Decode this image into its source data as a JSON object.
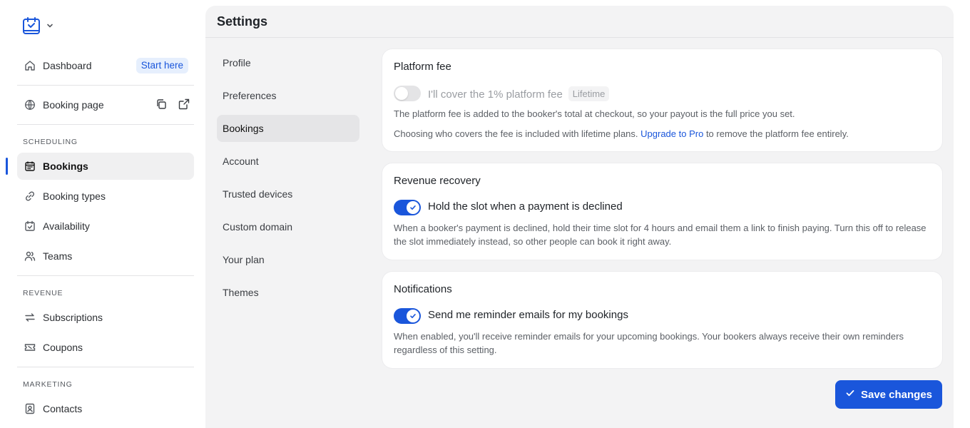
{
  "sidebar": {
    "logo_icon": "calendar-check-icon",
    "dashboard": {
      "label": "Dashboard",
      "badge": "Start here"
    },
    "booking_page": {
      "label": "Booking page"
    },
    "sections": [
      {
        "label": "SCHEDULING",
        "items": [
          "Bookings",
          "Booking types",
          "Availability",
          "Teams"
        ]
      },
      {
        "label": "REVENUE",
        "items": [
          "Subscriptions",
          "Coupons"
        ]
      },
      {
        "label": "MARKETING",
        "items": [
          "Contacts"
        ]
      }
    ],
    "active_item": "Bookings"
  },
  "main": {
    "title": "Settings",
    "sub_nav": [
      "Profile",
      "Preferences",
      "Bookings",
      "Account",
      "Trusted devices",
      "Custom domain",
      "Your plan",
      "Themes"
    ],
    "sub_nav_active": "Bookings",
    "cards": {
      "platform_fee": {
        "title": "Platform fee",
        "toggle_label": "I'll cover the 1% platform fee",
        "toggle_on": false,
        "pill": "Lifetime",
        "desc1": "The platform fee is added to the booker's total at checkout, so your payout is the full price you set.",
        "desc2_pre": "Choosing who covers the fee is included with lifetime plans.",
        "desc2_link": "Upgrade to Pro",
        "desc2_post": "to remove the platform fee entirely."
      },
      "revenue_recovery": {
        "title": "Revenue recovery",
        "toggle_label": "Hold the slot when a payment is declined",
        "toggle_on": true,
        "desc": "When a booker's payment is declined, hold their time slot for 4 hours and email them a link to finish paying. Turn this off to release the slot immediately instead, so other people can book it right away."
      },
      "notifications": {
        "title": "Notifications",
        "toggle_label": "Send me reminder emails for my bookings",
        "toggle_on": true,
        "desc": "When enabled, you'll receive reminder emails for your upcoming bookings. Your bookers always receive their own reminders regardless of this setting."
      }
    },
    "save_label": "Save changes"
  },
  "colors": {
    "accent": "#1a56db",
    "panel_bg": "#f3f3f4"
  }
}
